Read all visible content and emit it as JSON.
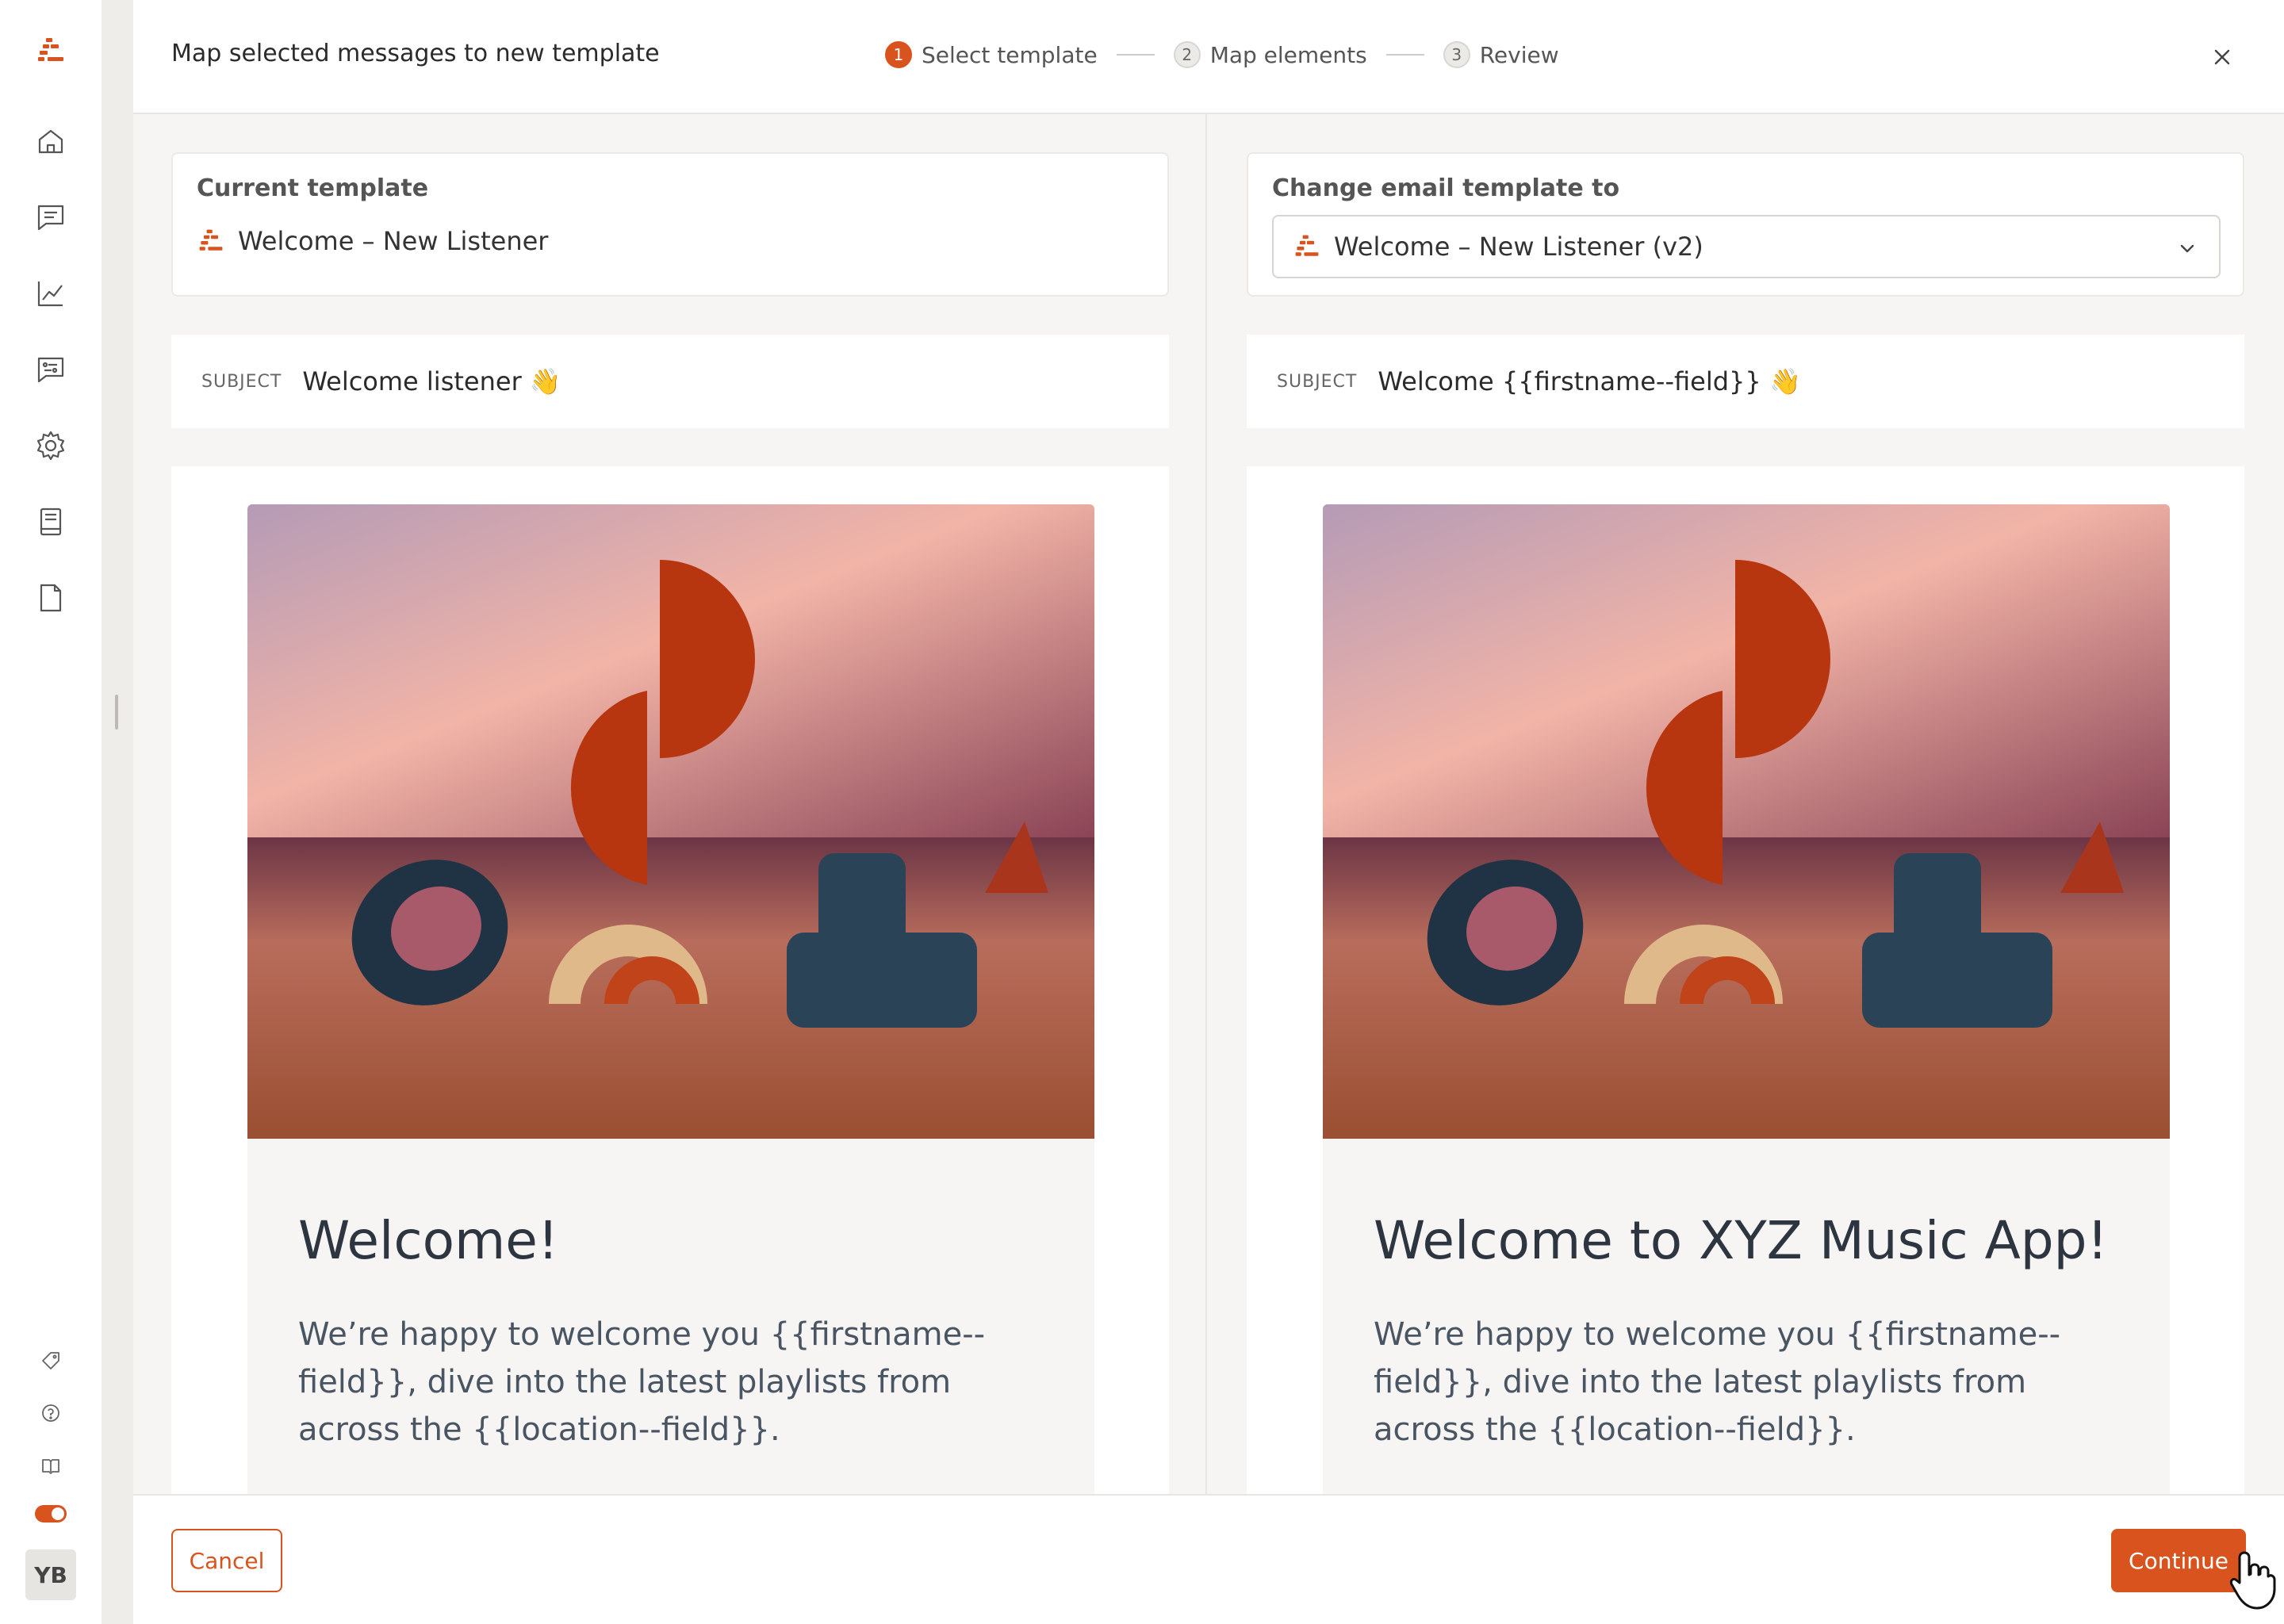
{
  "colors": {
    "accent": "#d9531e",
    "text": "#2b2b2b",
    "muted": "#666666"
  },
  "sidebar": {
    "nav_icons": [
      "home-icon",
      "messages-icon",
      "analytics-icon",
      "templates-icon",
      "settings-icon",
      "book-icon",
      "document-icon"
    ],
    "bottom_icons": [
      "tag-icon",
      "help-icon",
      "docs-icon"
    ],
    "avatar": "YB"
  },
  "modal": {
    "title": "Map selected messages to new template",
    "steps": [
      {
        "num": "1",
        "label": "Select template"
      },
      {
        "num": "2",
        "label": "Map elements"
      },
      {
        "num": "3",
        "label": "Review"
      }
    ]
  },
  "left": {
    "label": "Current template",
    "template_name": "Welcome – New Listener",
    "subject_label": "SUBJECT",
    "subject": "Welcome listener 👋",
    "heading": "Welcome!",
    "body": "We’re happy to welcome you {{firstname--field}}, dive into the latest playlists from across the {{location--field}}."
  },
  "right": {
    "label": "Change email template to",
    "template_name": "Welcome – New Listener (v2)",
    "subject_label": "SUBJECT",
    "subject": "Welcome {{firstname--field}} 👋",
    "heading": "Welcome to XYZ Music App!",
    "body": "We’re happy to welcome you {{firstname--field}}, dive into the latest playlists from across the {{location--field}}."
  },
  "footer": {
    "cancel": "Cancel",
    "continue": "Continue"
  }
}
